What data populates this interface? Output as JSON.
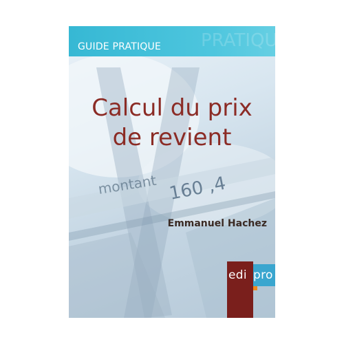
{
  "banner": {
    "label": "GUIDE PRATIQUE",
    "ghost_text": "PRATIQU"
  },
  "book": {
    "title_line1": "Calcul du prix",
    "title_line2": "de revient",
    "author": "Emmanuel Hachez"
  },
  "background_text": {
    "word": "montant",
    "amount": "160 ,4"
  },
  "publisher": {
    "logo_part1": "edi",
    "logo_part2": "pro"
  },
  "colors": {
    "banner": "#4ec6de",
    "title": "#8b2b25",
    "logo_dark": "#7a1f1c",
    "logo_blue": "#3aa6cf",
    "logo_accent": "#f08a1c"
  }
}
